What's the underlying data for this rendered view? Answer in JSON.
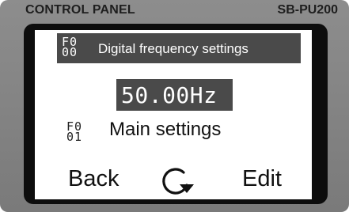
{
  "panel": {
    "title": "CONTROL PANEL",
    "model": "SB-PU200"
  },
  "display": {
    "param1": {
      "code_line1": "F0",
      "code_line2": "00",
      "label": "Digital frequency settings"
    },
    "value": "50.00Hz",
    "param2": {
      "code_line1": "F0",
      "code_line2": "01",
      "label": "Main settings"
    },
    "softkeys": {
      "left": "Back",
      "center_icon": "rotate-clockwise-icon",
      "right": "Edit"
    }
  },
  "colors": {
    "device_body": "#858585",
    "bezel": "#0d0d0d",
    "screen": "#ffffff",
    "highlight": "#4a4a4a"
  }
}
